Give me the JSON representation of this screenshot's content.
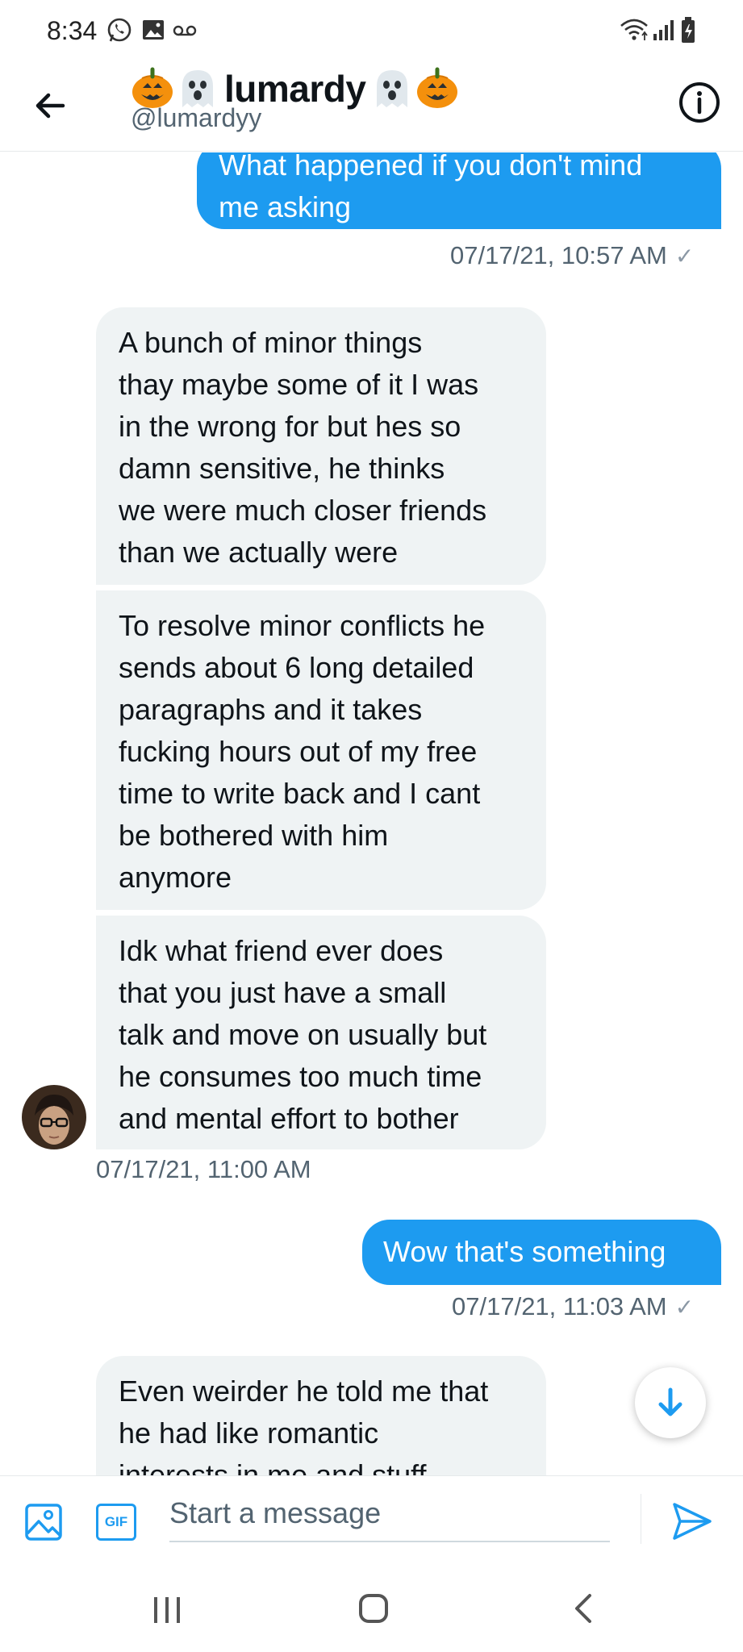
{
  "status_bar": {
    "time": "8:34",
    "icons": [
      "whatsapp-icon",
      "gallery-icon",
      "voicemail-icon",
      "wifi-icon",
      "signal-icon",
      "battery-charging-icon"
    ]
  },
  "header": {
    "display_name": "lumardy",
    "name_emojis": [
      "pumpkin-emoji",
      "ghost-emoji",
      "ghost-emoji",
      "pumpkin-emoji"
    ],
    "handle": "@lumardyy",
    "back_icon": "arrow-left-icon",
    "info_icon": "info-icon"
  },
  "messages": [
    {
      "direction": "out",
      "lines": [
        "What happened if you don't mind",
        "me asking"
      ],
      "timestamp": "07/17/21, 10:57 AM",
      "read_check": "✓"
    },
    {
      "direction": "in",
      "lines": [
        "A bunch of minor things",
        "thay maybe some of it I was",
        "in the wrong for but hes so",
        "damn sensitive, he thinks",
        "we were much closer friends",
        "than we actually were"
      ]
    },
    {
      "direction": "in",
      "lines": [
        "To resolve minor conflicts he",
        "sends about 6 long detailed",
        "paragraphs and it takes",
        "fucking hours out of my free",
        "time to write back and I cant",
        "be bothered with him",
        "anymore"
      ]
    },
    {
      "direction": "in",
      "lines": [
        "Idk what friend ever does",
        "that you just have a small",
        "talk and move on usually but",
        "he consumes too much time",
        "and mental effort to bother"
      ],
      "timestamp": "07/17/21, 11:00 AM"
    },
    {
      "direction": "out",
      "lines": [
        "Wow that's something"
      ],
      "timestamp": "07/17/21, 11:03 AM",
      "read_check": "✓"
    },
    {
      "direction": "in",
      "lines": [
        "Even weirder he told me that",
        "he had like romantic",
        "interests in me and stuff"
      ]
    }
  ],
  "composer": {
    "placeholder": "Start a message",
    "media_icon": "image-icon",
    "gif_label": "GIF",
    "send_icon": "send-icon"
  },
  "scroll_down_icon": "arrow-down-icon",
  "nav_bar": [
    "recent-apps-icon",
    "home-icon",
    "back-icon"
  ],
  "colors": {
    "accent": "#1d9bf0",
    "incoming_bubble": "#eff3f4",
    "secondary_text": "#536471",
    "check": "#8b98a5"
  }
}
